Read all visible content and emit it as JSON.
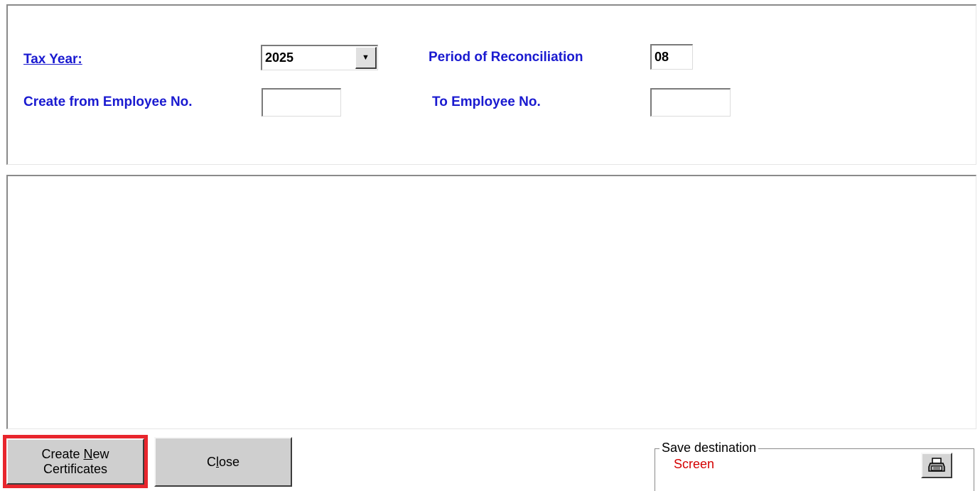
{
  "form": {
    "tax_year_label": "Tax Year:",
    "tax_year_value": "2025",
    "period_label": "Period of Reconciliation",
    "period_value": "08",
    "from_employee_label": "Create from Employee No.",
    "from_employee_value": "",
    "to_employee_label": "To Employee No.",
    "to_employee_value": ""
  },
  "buttons": {
    "create_line1_prefix": "Create ",
    "create_line1_mnemonic": "N",
    "create_line1_suffix": "ew",
    "create_line2": "Certificates",
    "close_mnemonic": "l",
    "close_prefix": "C",
    "close_suffix": "ose"
  },
  "save_destination": {
    "legend": "Save destination",
    "value": "Screen",
    "value_color": "#d40000"
  },
  "icons": {
    "combo_dropdown": "chevron-down-icon",
    "print": "printer-icon"
  },
  "colors": {
    "label_blue": "#1a1ad0",
    "highlight_red": "#e8262d"
  }
}
